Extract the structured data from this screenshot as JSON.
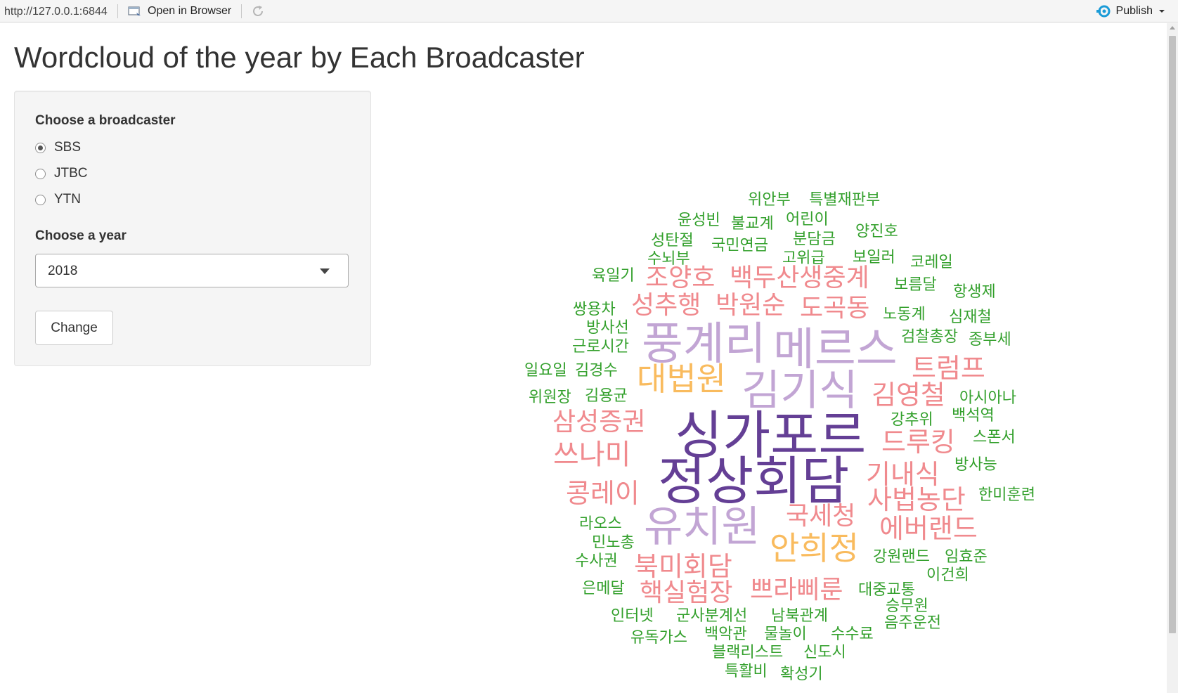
{
  "topbar": {
    "url": "http://127.0.0.1:6844",
    "open_in_browser": "Open in Browser",
    "publish": "Publish",
    "publish_icon_color": "#1a9bd7"
  },
  "page": {
    "title": "Wordcloud of the year by Each Broadcaster"
  },
  "sidebar": {
    "broadcaster_label": "Choose a broadcaster",
    "broadcasters": [
      {
        "label": "SBS",
        "checked": true
      },
      {
        "label": "JTBC",
        "checked": false
      },
      {
        "label": "YTN",
        "checked": false
      }
    ],
    "year_label": "Choose a year",
    "year_value": "2018",
    "change_button": "Change"
  },
  "wordcloud": {
    "palette": {
      "level1": "#643f95",
      "level2": "#c2a5d4",
      "level3": "#f9bb5e",
      "level4": "#f08a8e",
      "level5": "#33a02c"
    },
    "words": [
      "위안부",
      "특별재판부",
      "윤성빈",
      "불교계",
      "어린이",
      "양진호",
      "성탄절",
      "국민연금",
      "분담금",
      "수뇌부",
      "고위급",
      "보일러",
      "코레일",
      "육일기",
      "조양호",
      "백두산생중계",
      "보름달",
      "항생제",
      "쌍용차",
      "성추행",
      "박원순",
      "도곡동",
      "노동계",
      "심재철",
      "방사선",
      "풍계리",
      "메르스",
      "검찰총장",
      "종부세",
      "근로시간",
      "일요일",
      "김경수",
      "대법원",
      "김기식",
      "트럼프",
      "위원장",
      "김용균",
      "김영철",
      "아시아나",
      "삼성증권",
      "강추위",
      "백석역",
      "싱가포르",
      "드루킹",
      "스폰서",
      "쓰나미",
      "정상회담",
      "기내식",
      "방사능",
      "콩레이",
      "사법농단",
      "한미훈련",
      "국세청",
      "라오스",
      "유치원",
      "에버랜드",
      "민노총",
      "안희정",
      "수사권",
      "북미회담",
      "강원랜드",
      "임효준",
      "이건희",
      "은메달",
      "핵실험장",
      "쁘라삐룬",
      "대중교통",
      "승무원",
      "인터넷",
      "군사분계선",
      "남북관계",
      "음주운전",
      "유독가스",
      "백악관",
      "물놀이",
      "수수료",
      "블랙리스트",
      "신도시",
      "특활비",
      "확성기"
    ]
  }
}
